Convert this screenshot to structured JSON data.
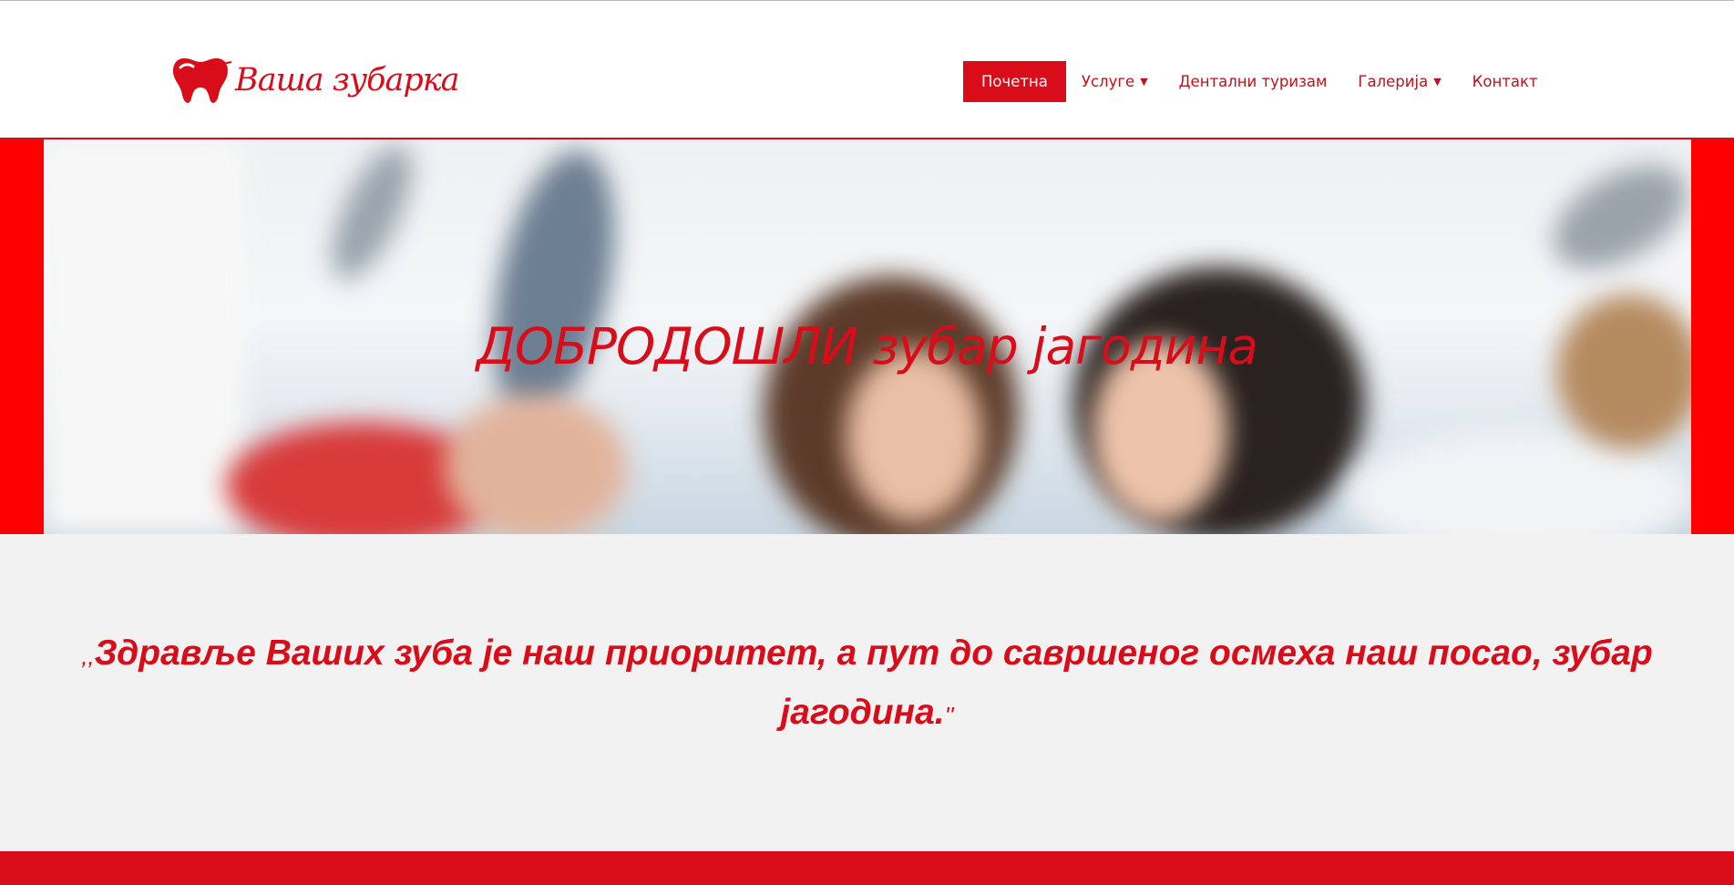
{
  "brand": {
    "name": "Ваша зубарка",
    "color": "#d90d1a",
    "logo_icon": "tooth-icon"
  },
  "nav": {
    "items": [
      {
        "label": "Почетна",
        "active": true,
        "dropdown": false
      },
      {
        "label": "Услуге",
        "active": false,
        "dropdown": true
      },
      {
        "label": "Дентални туризам",
        "active": false,
        "dropdown": false
      },
      {
        "label": "Галерија",
        "active": false,
        "dropdown": true
      },
      {
        "label": "Контакт",
        "active": false,
        "dropdown": false
      }
    ]
  },
  "hero": {
    "title": "ДОБРОДОШЛИ зубар јагодина"
  },
  "quote": {
    "open_mark": ",,",
    "text": "Здравље Ваших зуба је наш приоритет, а пут до савршеног осмеха наш посао, зубар јагодина.",
    "close_mark": "''"
  },
  "colors": {
    "accent": "#d90d1a",
    "hero_side": "#ff0000",
    "section_bg": "#f2f2f2"
  }
}
